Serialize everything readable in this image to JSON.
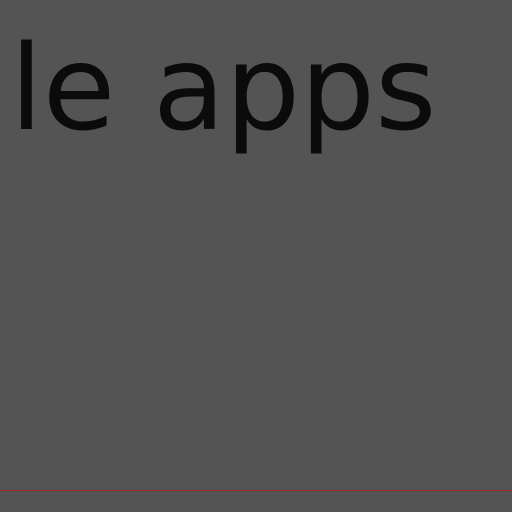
{
  "heading": {
    "text": "le apps",
    "color": "#0b0b0b"
  },
  "background": {
    "color": "#545454"
  },
  "divider": {
    "color": "#a02a2a"
  }
}
